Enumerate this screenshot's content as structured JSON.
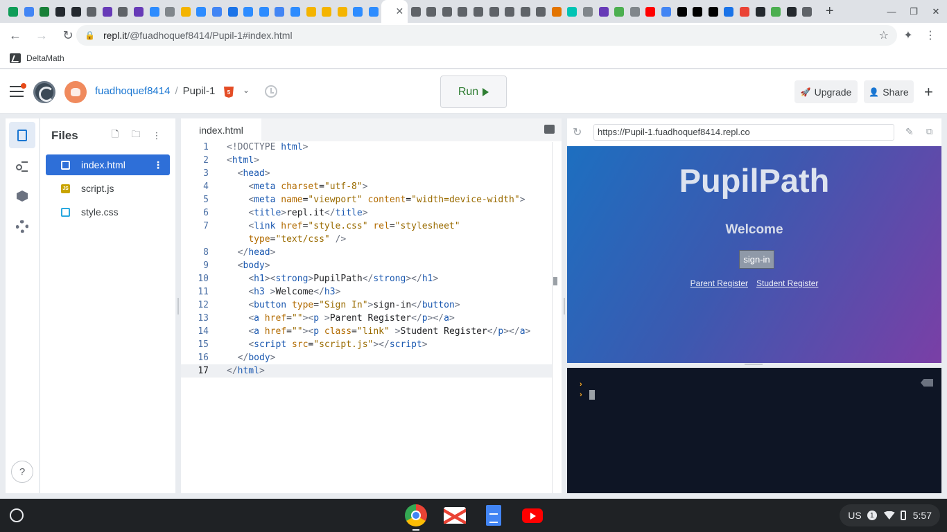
{
  "browser": {
    "tabs": [
      {
        "icon": "sheets-icon",
        "color": "#0f9d58"
      },
      {
        "icon": "docs-icon",
        "color": "#4285f4"
      },
      {
        "icon": "classroom-icon",
        "color": "#188038"
      },
      {
        "icon": "github-icon",
        "color": "#24292e"
      },
      {
        "icon": "github-icon",
        "color": "#24292e"
      },
      {
        "icon": "globe-icon",
        "color": "#5f6368"
      },
      {
        "icon": "forms-icon",
        "color": "#673ab7"
      },
      {
        "icon": "globe-icon",
        "color": "#5f6368"
      },
      {
        "icon": "forms-icon",
        "color": "#673ab7"
      },
      {
        "icon": "zoom-icon",
        "color": "#2d8cff"
      },
      {
        "icon": "list-icon",
        "color": "#80868b"
      },
      {
        "icon": "slides-icon",
        "color": "#f4b400"
      },
      {
        "icon": "zoom-icon",
        "color": "#2d8cff"
      },
      {
        "icon": "docs-icon",
        "color": "#4285f4"
      },
      {
        "icon": "contacts-icon",
        "color": "#1a73e8"
      },
      {
        "icon": "zoom-icon",
        "color": "#2d8cff"
      },
      {
        "icon": "zoom-icon",
        "color": "#2d8cff"
      },
      {
        "icon": "docs-icon",
        "color": "#4285f4"
      },
      {
        "icon": "zoom-icon",
        "color": "#2d8cff"
      },
      {
        "icon": "slides-icon",
        "color": "#f4b400"
      },
      {
        "icon": "slides-icon",
        "color": "#f4b400"
      },
      {
        "icon": "slides-icon",
        "color": "#f4b400"
      },
      {
        "icon": "zoom-icon",
        "color": "#2d8cff"
      },
      {
        "icon": "zoom-icon",
        "color": "#2d8cff"
      }
    ],
    "tabs_after": [
      {
        "icon": "globe-icon",
        "color": "#5f6368"
      },
      {
        "icon": "globe-icon",
        "color": "#5f6368"
      },
      {
        "icon": "globe-icon",
        "color": "#5f6368"
      },
      {
        "icon": "globe-icon",
        "color": "#5f6368"
      },
      {
        "icon": "globe-icon",
        "color": "#5f6368"
      },
      {
        "icon": "globe-icon",
        "color": "#5f6368"
      },
      {
        "icon": "globe-icon",
        "color": "#5f6368"
      },
      {
        "icon": "globe-icon",
        "color": "#5f6368"
      },
      {
        "icon": "globe-icon",
        "color": "#5f6368"
      },
      {
        "icon": "flag-icon",
        "color": "#e37400"
      },
      {
        "icon": "play-icon",
        "color": "#00c4b4"
      },
      {
        "icon": "list-icon",
        "color": "#80868b"
      },
      {
        "icon": "forms-icon",
        "color": "#673ab7"
      },
      {
        "icon": "badge-icon",
        "color": "#4caf50"
      },
      {
        "icon": "list-icon",
        "color": "#80868b"
      },
      {
        "icon": "youtube-icon",
        "color": "#ff0000"
      },
      {
        "icon": "google-icon",
        "color": "#4285f4"
      },
      {
        "icon": "openai-icon",
        "color": "#000000"
      },
      {
        "icon": "notion-icon",
        "color": "#000000"
      },
      {
        "icon": "notion-icon",
        "color": "#000000"
      },
      {
        "icon": "a-icon",
        "color": "#1a73e8"
      },
      {
        "icon": "gmail-icon",
        "color": "#ea4335"
      },
      {
        "icon": "github-icon",
        "color": "#24292e"
      },
      {
        "icon": "badge-icon",
        "color": "#4caf50"
      },
      {
        "icon": "github-icon",
        "color": "#24292e"
      },
      {
        "icon": "globe-icon",
        "color": "#5f6368"
      }
    ],
    "active_tab_close": "✕",
    "new_tab": "+",
    "url_host": "repl.it",
    "url_path": "/@fuadhoquef8414/Pupil-1#index.html",
    "bookmark": "DeltaMath"
  },
  "replit": {
    "username": "fuadhoquef8414",
    "separator": "/",
    "project": "Pupil-1",
    "run_label": "Run",
    "upgrade_label": "Upgrade",
    "share_label": "Share",
    "files_title": "Files",
    "files": [
      {
        "name": "index.html",
        "type": "html"
      },
      {
        "name": "script.js",
        "type": "js"
      },
      {
        "name": "style.css",
        "type": "css"
      }
    ],
    "help": "?"
  },
  "editor": {
    "tab_label": "index.html",
    "line_numbers": [
      "1",
      "2",
      "3",
      "4",
      "5",
      "6",
      "7",
      "",
      "8",
      "9",
      "10",
      "11",
      "12",
      "13",
      "14",
      "15",
      "16",
      "17"
    ]
  },
  "webview": {
    "url": "https://Pupil-1.fuadhoquef8414.repl.co",
    "title": "PupilPath",
    "welcome": "Welcome",
    "signin": "sign-in",
    "parent_register": "Parent Register",
    "student_register": "Student Register"
  },
  "system": {
    "locale": "US",
    "notifications": "1",
    "time": "5:57"
  },
  "colors": {
    "accent": "#2e6fd8",
    "run_green": "#2e7d32",
    "console_bg": "#0e1525"
  }
}
